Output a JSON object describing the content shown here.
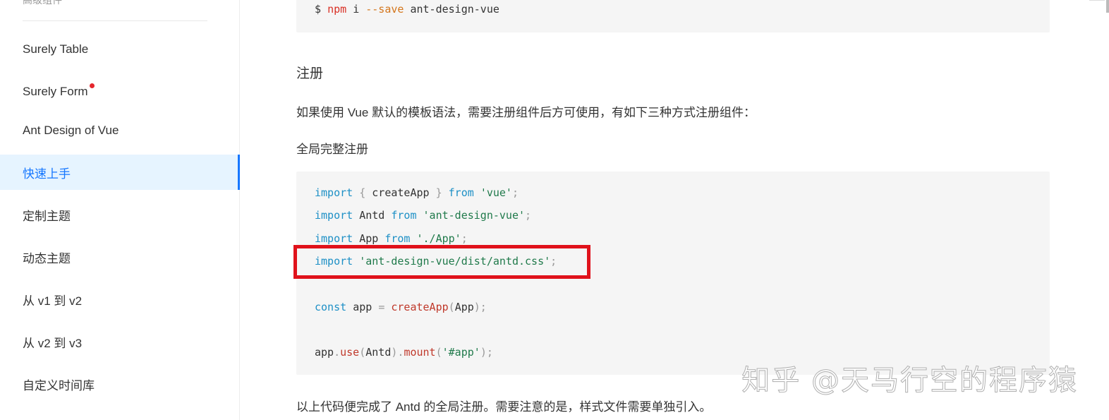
{
  "sidebar": {
    "group_title": "高级组件",
    "items": [
      {
        "label": "Surely Table",
        "active": false,
        "new": false
      },
      {
        "label": "Surely Form",
        "active": false,
        "new": true
      },
      {
        "label": "Ant Design of Vue",
        "active": false,
        "new": false
      },
      {
        "label": "快速上手",
        "active": true,
        "new": false
      },
      {
        "label": "定制主题",
        "active": false,
        "new": false
      },
      {
        "label": "动态主题",
        "active": false,
        "new": false
      },
      {
        "label": "从 v1 到 v2",
        "active": false,
        "new": false
      },
      {
        "label": "从 v2 到 v3",
        "active": false,
        "new": false
      },
      {
        "label": "自定义时间库",
        "active": false,
        "new": false
      }
    ],
    "accent_color": "#1677ff"
  },
  "main": {
    "install_code": {
      "prompt": "$",
      "cmd": "npm",
      "sub": "i",
      "flag": "--save",
      "pkg": "ant-design-vue"
    },
    "register_heading": "注册",
    "register_desc": "如果使用 Vue 默认的模板语法，需要注册组件后方可使用，有如下三种方式注册组件：",
    "global_heading": "全局完整注册",
    "code": {
      "l1": {
        "kw": "import",
        "ob": "{",
        "name": "createApp",
        "cb": "}",
        "from": "from",
        "str": "'vue'",
        "semi": ";"
      },
      "l2": {
        "kw": "import",
        "name": "Antd",
        "from": "from",
        "str": "'ant-design-vue'",
        "semi": ";"
      },
      "l3": {
        "kw": "import",
        "name": "App",
        "from": "from",
        "str": "'./App'",
        "semi": ";"
      },
      "l4": {
        "kw": "import",
        "str": "'ant-design-vue/dist/antd.css'",
        "semi": ";"
      },
      "l5": {
        "kw": "const",
        "name": "app",
        "eq": "=",
        "fn": "createApp",
        "op": "(",
        "arg": "App",
        "cp": ");"
      },
      "l6": {
        "obj": "app",
        "dot1": ".",
        "fn": "use",
        "op": "(",
        "arg": "Antd",
        "cp": ")",
        "dot2": ".",
        "fn2": "mount",
        "op2": "(",
        "str": "'#app'",
        "cp2": ");"
      }
    },
    "summary": "以上代码便完成了 Antd 的全局注册。需要注意的是，样式文件需要单独引入。",
    "highlight_color": "#e0121b"
  },
  "watermark": "知乎 @天马行空的程序猿"
}
